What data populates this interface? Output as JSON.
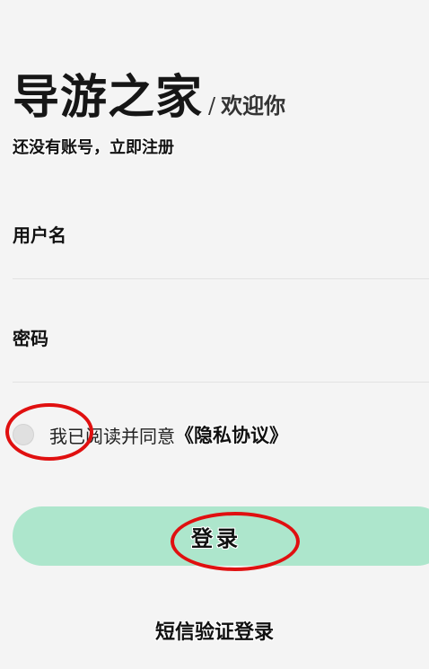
{
  "header": {
    "title": "导游之家",
    "separator": "/",
    "welcome": "欢迎你",
    "register_link": "还没有账号，立即注册"
  },
  "form": {
    "username_placeholder": "用户名",
    "password_placeholder": "密码",
    "agree_text": "我已阅读并同意",
    "agree_link": "《隐私协议》",
    "agree_checked": false,
    "login_label": "登录",
    "sms_login_label": "短信验证登录"
  },
  "colors": {
    "background": "#f4f4f4",
    "login_button": "#ade6cc",
    "annotation": "#e01010"
  }
}
